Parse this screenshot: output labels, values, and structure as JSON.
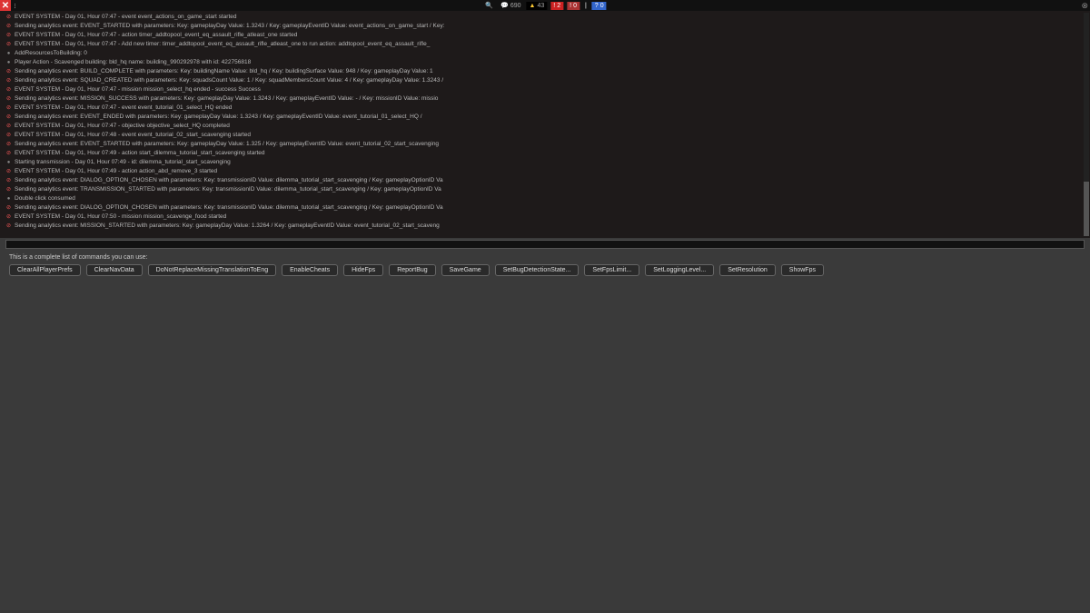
{
  "topbar": {
    "close": "✕",
    "status": {
      "search": "🔍",
      "chat": "💬",
      "chat_count": "690",
      "warn": "▲",
      "warn_count": "43",
      "err1": "!",
      "err1_count": "2",
      "err2": "!",
      "err2_count": "0",
      "info_icon": "|",
      "info_count": "",
      "q": "?",
      "q_count": "0"
    },
    "right_close": "⊗"
  },
  "log": [
    "EVENT SYSTEM - Day 01, Hour 07:47 - event event_actions_on_game_start started",
    "Sending analytics event: EVENT_STARTED with parameters: Key: gameplayDay Value: 1.3243 / Key: gameplayEventID Value: event_actions_on_game_start / Key:",
    "EVENT SYSTEM - Day 01, Hour 07:47 - action timer_addtopool_event_eq_assault_rifle_atleast_one started",
    "EVENT SYSTEM - Day 01, Hour 07:47 - Add new timer: timer_addtopool_event_eq_assault_rifle_atleast_one to run action: addtopool_event_eq_assault_rifle_",
    "AddResourcesToBuilding: 0",
    "Player Action - Scavenged building: bld_hq name: building_990292978 with id: 422756818",
    "Sending analytics event: BUILD_COMPLETE with parameters: Key: buildingName Value: bld_hq / Key: buildingSurface Value: 948 / Key: gameplayDay Value: 1",
    "Sending analytics event: SQUAD_CREATED with parameters: Key: squadsCount Value: 1 / Key: squadMembersCount Value: 4 / Key: gameplayDay Value: 1.3243 /",
    "EVENT SYSTEM - Day 01, Hour 07:47 - mission mission_select_hq ended - success Success",
    "Sending analytics event: MISSION_SUCCESS with parameters: Key: gameplayDay Value: 1.3243 / Key: gameplayEventID Value: - / Key: missionID Value: missio",
    "EVENT SYSTEM - Day 01, Hour 07:47 - event event_tutorial_01_select_HQ ended",
    "Sending analytics event: EVENT_ENDED with parameters: Key: gameplayDay Value: 1.3243 / Key: gameplayEventID Value: event_tutorial_01_select_HQ /",
    "EVENT SYSTEM - Day 01, Hour 07:47 - objective objective_select_HQ completed",
    "EVENT SYSTEM - Day 01, Hour 07:48 - event event_tutorial_02_start_scavenging started",
    "Sending analytics event: EVENT_STARTED with parameters: Key: gameplayDay Value: 1.325 / Key: gameplayEventID Value: event_tutorial_02_start_scavenging",
    "EVENT SYSTEM - Day 01, Hour 07:49 - action start_dilemma_tutorial_start_scavenging started",
    "Starting transmission - Day 01, Hour 07:49 - id: dilemma_tutorial_start_scavenging",
    "EVENT SYSTEM - Day 01, Hour 07:49 - action action_abd_remove_3 started",
    "Sending analytics event: DIALOG_OPTION_CHOSEN with parameters: Key: transmissionID Value: dilemma_tutorial_start_scavenging / Key: gameplayOptionID Va",
    "Sending analytics event: TRANSMISSION_STARTED with parameters: Key: transmissionID Value: dilemma_tutorial_start_scavenging / Key: gameplayOptionID Va",
    "Double click consumed",
    "Sending analytics event: DIALOG_OPTION_CHOSEN with parameters: Key: transmissionID Value: dilemma_tutorial_start_scavenging / Key: gameplayOptionID Va",
    "EVENT SYSTEM - Day 01, Hour 07:50 - mission mission_scavenge_food started",
    "Sending analytics event: MISSION_STARTED with parameters: Key: gameplayDay Value: 1.3264 / Key: gameplayEventID Value: event_tutorial_02_start_scaveng"
  ],
  "log_icons": [
    "err",
    "err",
    "err",
    "err",
    "info",
    "info",
    "err",
    "err",
    "err",
    "err",
    "err",
    "err",
    "err",
    "err",
    "err",
    "err",
    "info",
    "err",
    "err",
    "err",
    "info",
    "err",
    "err",
    "err"
  ],
  "hint": "This is a complete list of commands you can use:",
  "commands": [
    "ClearAllPlayerPrefs",
    "ClearNavData",
    "DoNotReplaceMissingTranslationToEng",
    "EnableCheats",
    "HideFps",
    "ReportBug",
    "SaveGame",
    "SetBugDetectionState...",
    "SetFpsLimit...",
    "SetLoggingLevel...",
    "SetResolution",
    "ShowFps"
  ]
}
